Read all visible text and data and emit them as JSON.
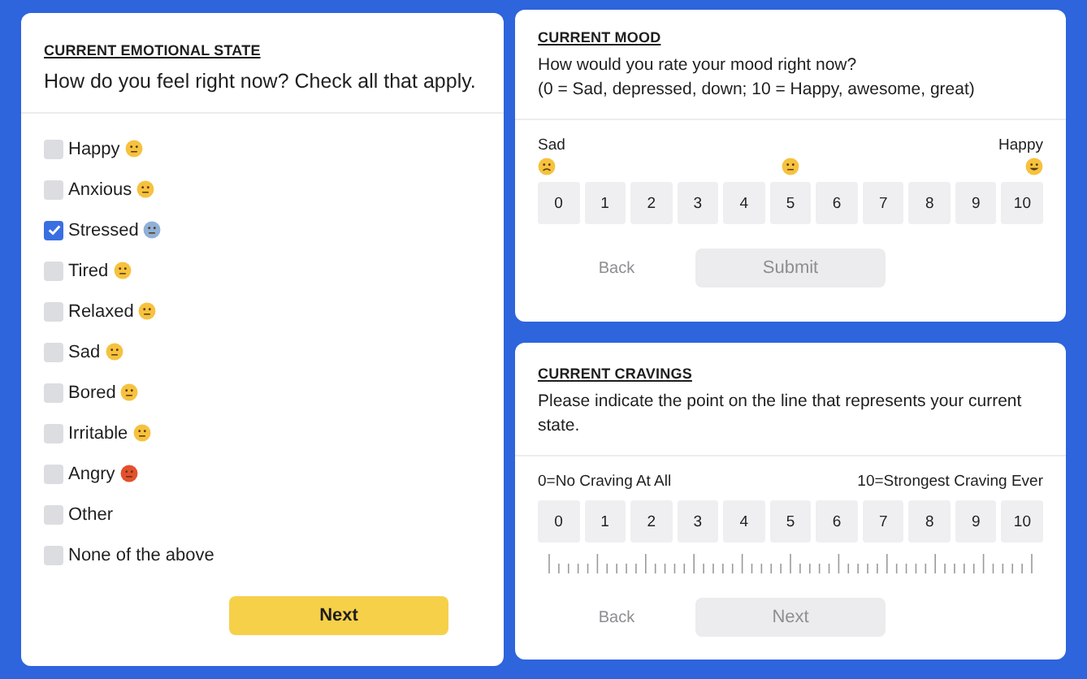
{
  "emotional_state": {
    "heading": "CURRENT EMOTIONAL STATE",
    "question": "How do you feel right now? Check all that apply.",
    "options": [
      {
        "label": "Happy",
        "checked": false,
        "color": "#f6c23e"
      },
      {
        "label": "Anxious",
        "checked": false,
        "color": "#f6c23e"
      },
      {
        "label": "Stressed",
        "checked": true,
        "color": "#8fb0d8"
      },
      {
        "label": "Tired",
        "checked": false,
        "color": "#f6c23e"
      },
      {
        "label": "Relaxed",
        "checked": false,
        "color": "#f6c23e"
      },
      {
        "label": "Sad",
        "checked": false,
        "color": "#f6c23e"
      },
      {
        "label": "Bored",
        "checked": false,
        "color": "#f6c23e"
      },
      {
        "label": "Irritable",
        "checked": false,
        "color": "#f6c23e"
      },
      {
        "label": "Angry",
        "checked": false,
        "color": "#e4502e"
      },
      {
        "label": "Other",
        "checked": false
      },
      {
        "label": "None of the above",
        "checked": false
      }
    ],
    "next_button": {
      "label": "Next",
      "disabled": false
    }
  },
  "mood": {
    "heading": "CURRENT MOOD",
    "question_lines": [
      "How would you rate your mood right now?",
      "(0 = Sad, depressed, down; 10 = Happy, awesome, great)"
    ],
    "low_label": "Sad",
    "high_label": "Happy",
    "scale": [
      {
        "label": "0",
        "selected": false
      },
      {
        "label": "1",
        "selected": false
      },
      {
        "label": "2",
        "selected": false
      },
      {
        "label": "3",
        "selected": false
      },
      {
        "label": "4",
        "selected": false
      },
      {
        "label": "5",
        "selected": false
      },
      {
        "label": "6",
        "selected": false
      },
      {
        "label": "7",
        "selected": false
      },
      {
        "label": "8",
        "selected": false
      },
      {
        "label": "9",
        "selected": false
      },
      {
        "label": "10",
        "selected": false
      }
    ],
    "back_button": {
      "label": "Back"
    },
    "submit_button": {
      "label": "Submit",
      "disabled": true
    }
  },
  "cravings": {
    "heading": "CURRENT CRAVINGS",
    "question": "Please indicate the point on the line that represents your current state.",
    "low_label": "0=No Craving At All",
    "high_label": "10=Strongest Craving Ever",
    "scale": [
      {
        "label": "0",
        "selected": false
      },
      {
        "label": "1",
        "selected": false
      },
      {
        "label": "2",
        "selected": false
      },
      {
        "label": "3",
        "selected": false
      },
      {
        "label": "4",
        "selected": false
      },
      {
        "label": "5",
        "selected": false
      },
      {
        "label": "6",
        "selected": false
      },
      {
        "label": "7",
        "selected": false
      },
      {
        "label": "8",
        "selected": false
      },
      {
        "label": "9",
        "selected": false
      },
      {
        "label": "10",
        "selected": false
      }
    ],
    "back_button": {
      "label": "Back"
    },
    "next_button": {
      "label": "Next",
      "disabled": true
    }
  }
}
